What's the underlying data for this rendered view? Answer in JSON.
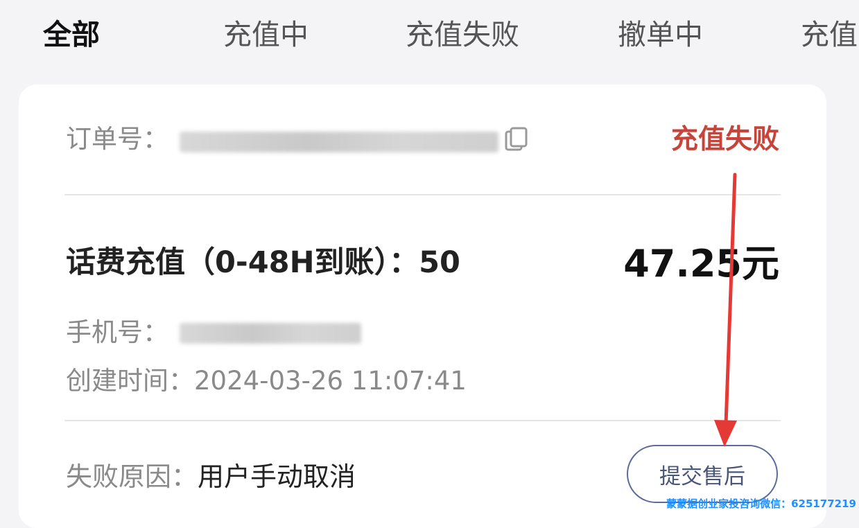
{
  "tabs": [
    {
      "label": "全部",
      "active": true
    },
    {
      "label": "充值中"
    },
    {
      "label": "充值失败"
    },
    {
      "label": "撤单中"
    },
    {
      "label": "充值"
    }
  ],
  "order": {
    "order_no_label": "订单号：",
    "order_no_value": "17（已打码）",
    "status": "充值失败",
    "product": "话费充值（0-48H到账）：50",
    "price": "47.25元",
    "phone_label": "手机号：",
    "phone_value": "（已打码）",
    "created_label": "创建时间：",
    "created_value": "2024-03-26 11:07:41",
    "fail_label": "失败原因：",
    "fail_value": "用户手动取消",
    "after_sale_button": "提交售后"
  },
  "colors": {
    "status_red": "#c7443a",
    "button_border": "#5c6c9a",
    "annotation_arrow": "#e53935"
  },
  "icons": {
    "copy": "copy-icon"
  },
  "watermark": "蒙蒙据创业家投咨询微信：625177219"
}
